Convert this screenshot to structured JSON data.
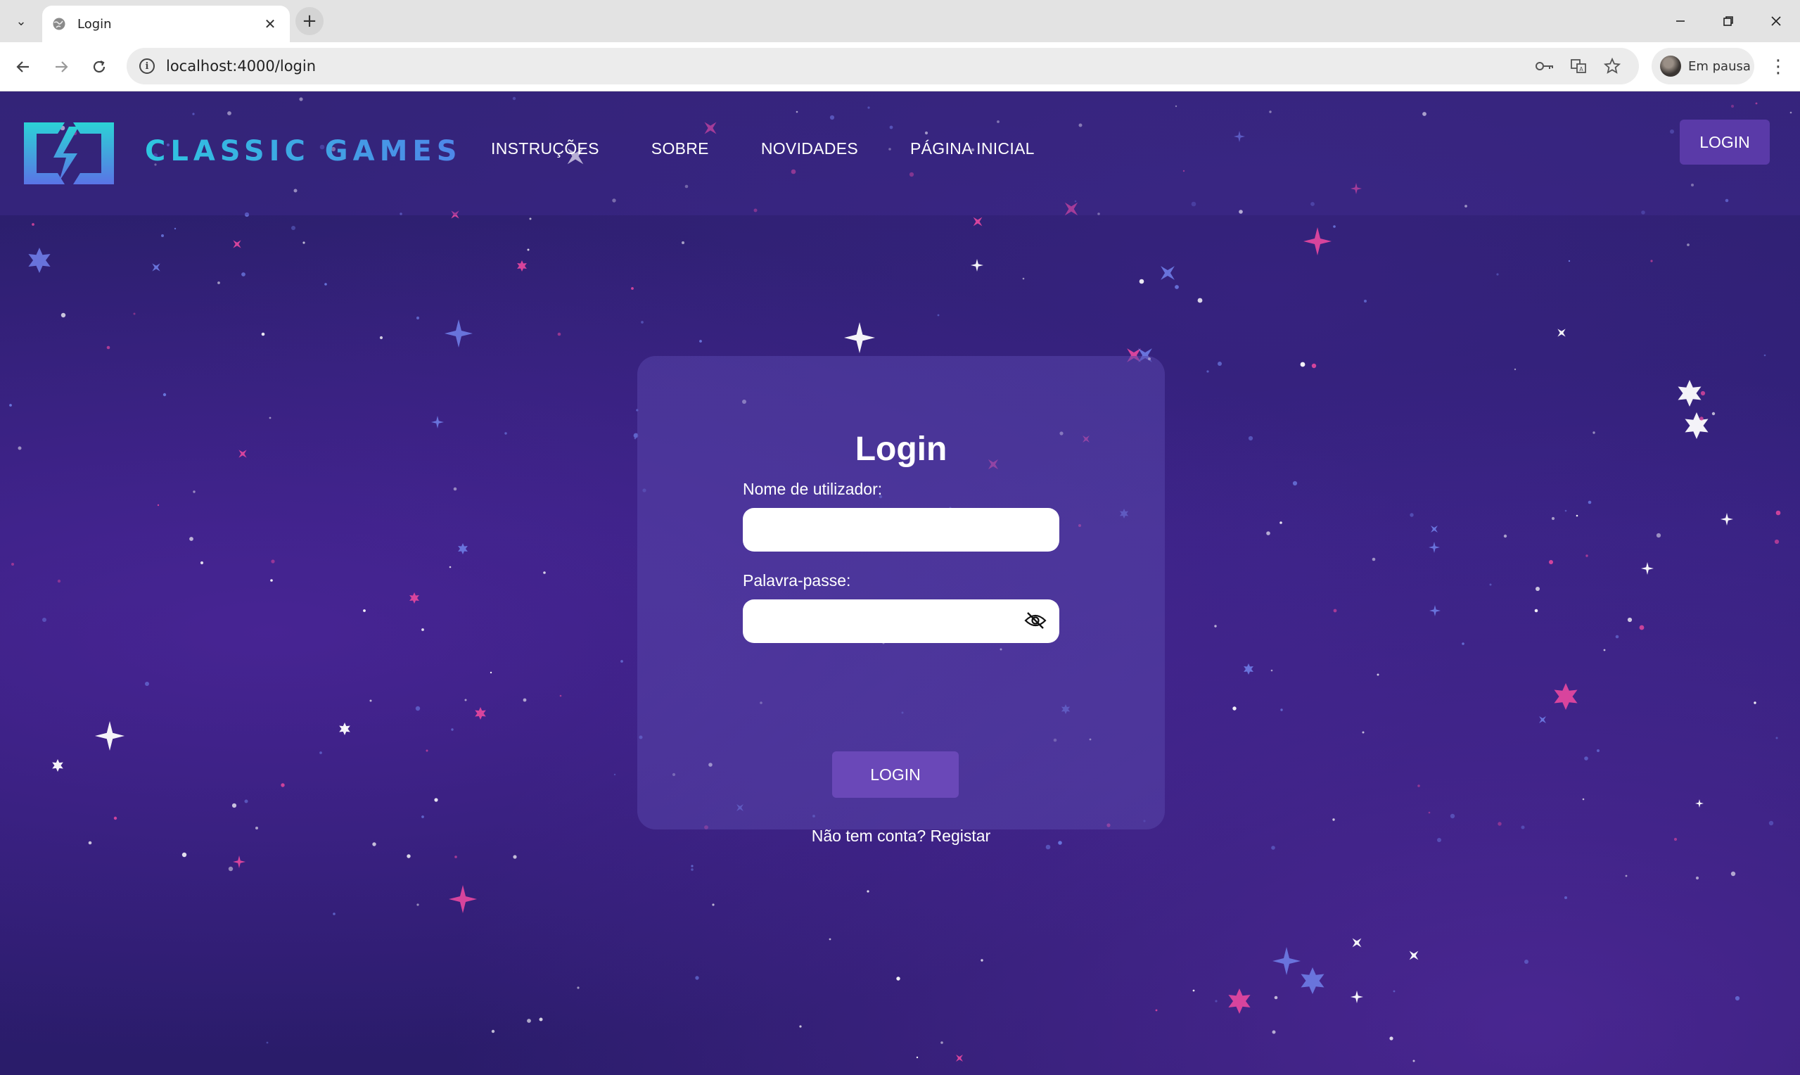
{
  "browser": {
    "tab_title": "Login",
    "url": "localhost:4000/login",
    "profile_status": "Em pausa"
  },
  "site": {
    "brand": "CLASSIC GAMES",
    "nav": [
      "INSTRUÇÕES",
      "SOBRE",
      "NOVIDADES",
      "PÁGINA INICIAL"
    ],
    "header_login": "LOGIN"
  },
  "login_form": {
    "title": "Login",
    "username_label": "Nome de utilizador:",
    "username_value": "",
    "password_label": "Palavra-passe:",
    "password_value": "",
    "submit_label": "LOGIN",
    "no_account_text": "Não tem conta?",
    "register_link": "Registar"
  },
  "colors": {
    "background": "#2a1f69",
    "header_button": "#5a3aa8",
    "submit_button": "#6a48b8",
    "brand_gradient_start": "#2ec6e0",
    "brand_gradient_end": "#4f86e8",
    "star_white": "#ffffff",
    "star_pink": "#e0479e",
    "star_blue": "#6b78e0"
  },
  "icons": {
    "password_toggle": "eye-slash-icon",
    "tab_favicon": "globe-icon"
  }
}
